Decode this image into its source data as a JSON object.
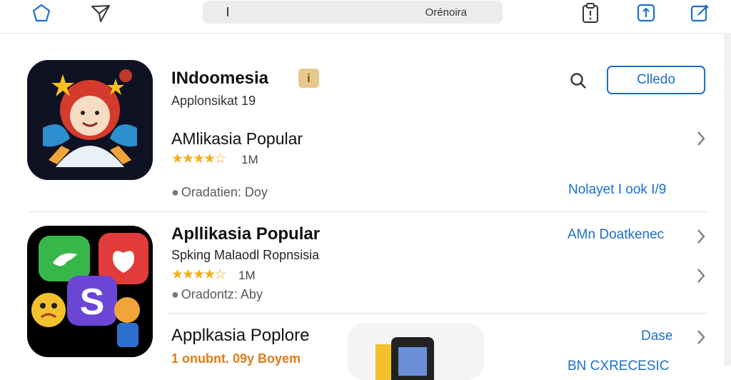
{
  "search": {
    "value": "Orénoira"
  },
  "colors": {
    "accent": "#1a6fd1",
    "star": "#f2b01e",
    "badge": "#e7c98d"
  },
  "top_icons": [
    "home-icon",
    "send-icon",
    "clipboard-icon",
    "share-icon",
    "edit-icon"
  ],
  "featured": {
    "title": "INdoomesia",
    "subtitle": "Applonsikat 19",
    "badge": "i",
    "get_label": "Clledo",
    "section_title": "AMlikasia Popular",
    "stars": "★★★★☆",
    "count": "1M",
    "meta": "Oradatien: Doy",
    "link": "Nolayet I ook I/9"
  },
  "second": {
    "title": "Apllikasia Popular",
    "subtitle": "Spking Malaodl Ropnsisia",
    "stars": "★★★★☆",
    "count": "1M",
    "meta": "Oradontz: Aby",
    "link": "AMn Doatkenec"
  },
  "third": {
    "title": "Applkasia Poplore",
    "meta": "1 onubnt. 09y Boyem",
    "link": "Dase",
    "link2": "BN CXRECESIC"
  }
}
